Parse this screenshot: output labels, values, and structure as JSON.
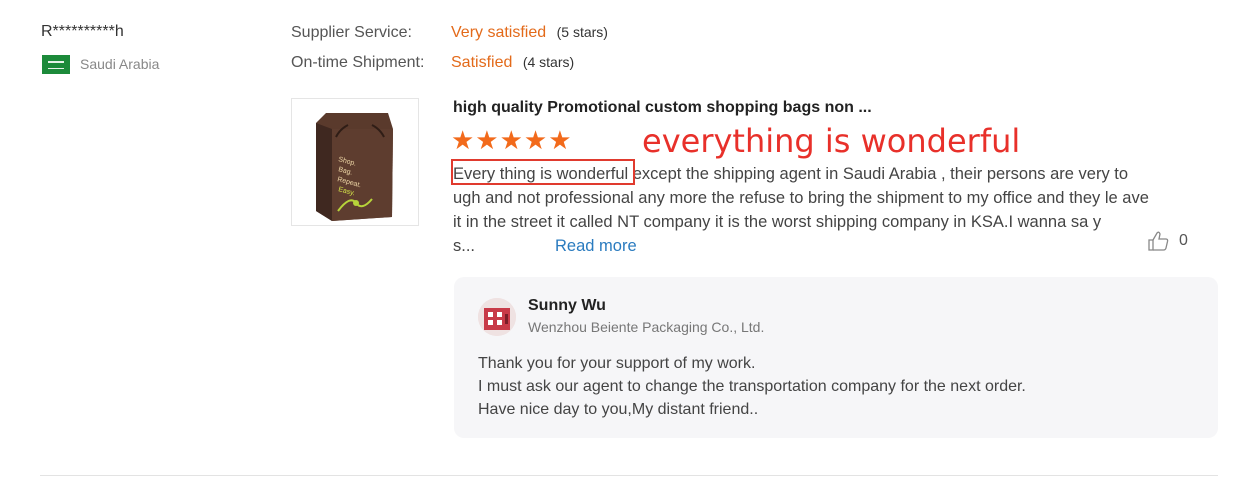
{
  "reviewer": {
    "name": "R**********h",
    "country": "Saudi Arabia"
  },
  "ratings": [
    {
      "label": "Supplier Service:",
      "value": "Very satisfied",
      "stars_text": "(5 stars)"
    },
    {
      "label": "On-time Shipment:",
      "value": "Satisfied",
      "stars_text": "(4 stars)"
    }
  ],
  "product": {
    "title": "high quality Promotional custom shopping bags non ...",
    "image_text": "Shop. Bag. Repeat. Easy.",
    "star_count": 5,
    "stars": "★★★★★"
  },
  "annotation": "everything is wonderful",
  "review": {
    "highlight": "Every thing is wonderful",
    "text": " except the shipping agent in Saudi Arabia , their persons are very to ugh and not professional any more the refuse to bring the shipment to my office and they le ave it in the street it called NT company it is the worst shipping company in KSA.I wanna sa y s...",
    "read_more": "Read more",
    "likes": "0"
  },
  "reply": {
    "name": "Sunny Wu",
    "company": "Wenzhou Beiente Packaging Co., Ltd.",
    "lines": [
      "Thank you for your support of my work.",
      "I must ask our agent to change the transportation company for the next order.",
      "Have nice day to you,My distant friend.."
    ]
  },
  "colors": {
    "accent_orange": "#e36a1a",
    "star_orange": "#f26a1b",
    "link_blue": "#2a7bbf",
    "annotation_red": "#e8302a"
  }
}
